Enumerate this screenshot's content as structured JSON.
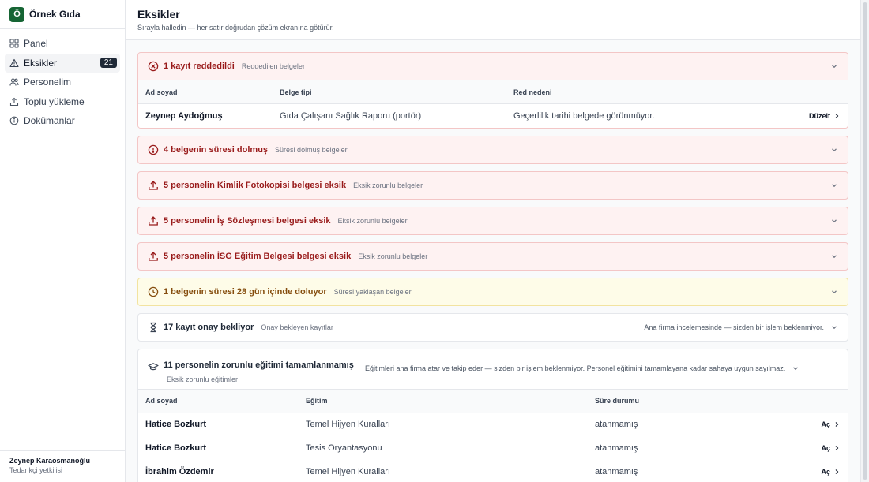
{
  "brand": {
    "logo_letter": "Ö",
    "name": "Örnek Gıda"
  },
  "nav": [
    {
      "label": "Panel",
      "icon": "grid-icon"
    },
    {
      "label": "Eksikler",
      "icon": "warning-triangle-icon",
      "badge": "21",
      "active": true
    },
    {
      "label": "Personelim",
      "icon": "users-icon"
    },
    {
      "label": "Toplu yükleme",
      "icon": "upload-icon"
    },
    {
      "label": "Dokümanlar",
      "icon": "info-icon"
    }
  ],
  "user": {
    "name": "Zeynep Karaosmanoğlu",
    "role": "Tedarikçi yetkilisi"
  },
  "header": {
    "title": "Eksikler",
    "subtitle": "Sırayla halledin — her satır doğrudan çözüm ekranına götürür."
  },
  "rejected": {
    "title": "1 kayıt reddedildi",
    "subtitle": "Reddedilen belgeler",
    "columns": [
      "Ad soyad",
      "Belge tipi",
      "Red nedeni"
    ],
    "rows": [
      {
        "name": "Zeynep Aydoğmuş",
        "doc": "Gıda Çalışanı Sağlık Raporu (portör)",
        "reason": "Geçerlilik tarihi belgede görünmüyor.",
        "action": "Düzelt"
      }
    ]
  },
  "expired": {
    "title": "4 belgenin süresi dolmuş",
    "subtitle": "Süresi dolmuş belgeler"
  },
  "missing": [
    {
      "title": "5 personelin Kimlik Fotokopisi belgesi eksik",
      "subtitle": "Eksik zorunlu belgeler"
    },
    {
      "title": "5 personelin İş Sözleşmesi belgesi eksik",
      "subtitle": "Eksik zorunlu belgeler"
    },
    {
      "title": "5 personelin İSG Eğitim Belgesi belgesi eksik",
      "subtitle": "Eksik zorunlu belgeler"
    }
  ],
  "expiring": {
    "title": "1 belgenin süresi 28 gün içinde doluyor",
    "subtitle": "Süresi yaklaşan belgeler"
  },
  "pending": {
    "title": "17 kayıt onay bekliyor",
    "subtitle": "Onay bekleyen kayıtlar",
    "note": "Ana firma incelemesinde — sizden bir işlem beklenmiyor."
  },
  "training": {
    "title": "11 personelin zorunlu eğitimi tamamlanmamış",
    "subtitle": "Eksik zorunlu eğitimler",
    "note": "Eğitimleri ana firma atar ve takip eder — sizden bir işlem beklenmiyor. Personel eğitimini tamamlayana kadar sahaya uygun sayılmaz.",
    "columns": [
      "Ad soyad",
      "Eğitim",
      "Süre durumu"
    ],
    "rows": [
      {
        "name": "Hatice Bozkurt",
        "training": "Temel Hijyen Kuralları",
        "status": "atanmamış",
        "action": "Aç"
      },
      {
        "name": "Hatice Bozkurt",
        "training": "Tesis Oryantasyonu",
        "status": "atanmamış",
        "action": "Aç"
      },
      {
        "name": "İbrahim Özdemir",
        "training": "Temel Hijyen Kuralları",
        "status": "atanmamış",
        "action": "Aç"
      }
    ]
  },
  "colors": {
    "brand": "#166534",
    "danger": "#991b1b",
    "warning": "#854d0e"
  }
}
